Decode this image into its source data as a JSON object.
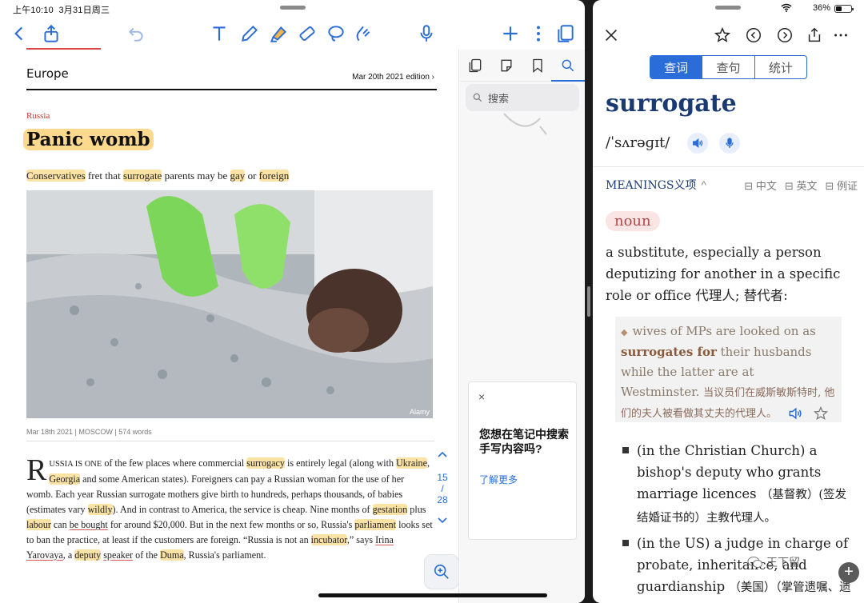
{
  "left_status": {
    "time": "上午10:10",
    "date": "3月31日周三"
  },
  "right_status": {
    "battery": "36%"
  },
  "document": {
    "section": "Europe",
    "edition": "Mar 20th 2021 edition",
    "edition_chevron": "›",
    "kicker": "Russia",
    "headline": "Panic womb",
    "subheadline": {
      "w1": "Conservatives",
      "t1": " fret that ",
      "w2": "surrogate",
      "t2": " parents may be ",
      "w3": "gay",
      "t3": " or ",
      "w4": "foreign"
    },
    "photo_credit": "Alamy",
    "dateline": "Mar 18th 2021 | MOSCOW | 574 words",
    "body": {
      "dropcap": "R",
      "smallcaps": "USSIA IS ONE",
      "s1": " of the few places where commercial ",
      "hl1": "surrogacy",
      "s2": " is entirely legal (along with ",
      "hl2": "Ukraine",
      "s3": ", ",
      "hl3": "Georgia",
      "s4": " and some American states). Foreigners can pay a Russian woman for the use of her womb. Each year Russian surrogate mothers give birth to hundreds, perhaps thousands, of babies (estimates vary ",
      "hl4": "wildly",
      "s5": "). And in contrast to America, the service is cheap. Nine months of ",
      "hl5": "gestation",
      "s6": " plus ",
      "hl6": "labour",
      "s7": " can ",
      "ul1": "be bought",
      "s8": " for around $20,000. But in the next few months or so, Russia's ",
      "hl7": "parliament",
      "s9": " looks set to ban the practice, at least if the customers are foreign. “Russia is not an ",
      "hl8": "incubator",
      "s10": ",” says ",
      "ul2": "Irina Yarovaya",
      "s11": ", a ",
      "hl9": "deputy",
      "s12": " ",
      "ul3": "speaker",
      "s13": " of the ",
      "hl10": "Duma",
      "s14": ", Russia's parliament."
    },
    "page_current": "15",
    "page_sep": "/",
    "page_total": "28"
  },
  "sidebar": {
    "search_placeholder": "搜索",
    "tip_title": "您想在笔记中搜索手写内容吗?",
    "tip_link": "了解更多",
    "tip_close": "×"
  },
  "dictionary": {
    "tabs": [
      "查词",
      "查句",
      "统计"
    ],
    "word": "surrogate",
    "phonetic": "/ˈsʌrəɡɪt/",
    "meanings_label": "MEANINGS义项",
    "meanings_chevron": "^",
    "filters": [
      "中文",
      "英文",
      "例证"
    ],
    "pos": "noun",
    "definition": "a substitute, especially a person deputizing for another in a specific role or office 代理人; 替代者:",
    "example": {
      "bullet": "◆",
      "en1": "wives of MPs are looked on as ",
      "kw": "surrogates for",
      "en2": " their husbands while the latter are at Westminster.",
      "cn": "当议员们在威斯敏斯特时, 他们的夫人被看做其丈夫的代理人。"
    },
    "sense2": {
      "en": "(in the Christian Church) a bishop's deputy who grants marriage licences",
      "cn": "（基督教）(签发结婚证书的）主教代理人。"
    },
    "sense3": {
      "en": "(in the US) a judge in charge of probate, inheritance, and guardianship",
      "cn": "（美国）（掌管遗嘱、遗产..."
    },
    "watermark": "王下留"
  },
  "colors": {
    "accent": "#2a6dd9",
    "highlight": "#fbe3a6",
    "headword": "#1a3a73"
  }
}
